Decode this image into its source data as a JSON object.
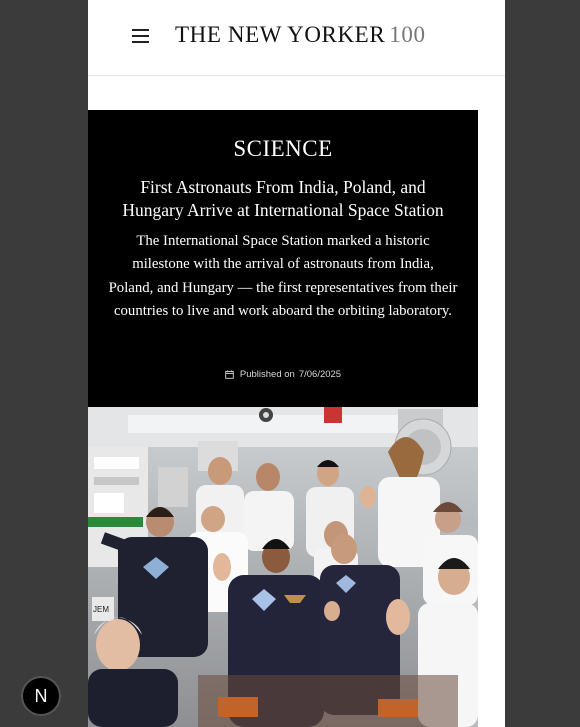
{
  "header": {
    "brand_title": "THE NEW YORKER",
    "brand_number": "100",
    "menu_icon": "hamburger-menu-icon"
  },
  "article": {
    "section": "SCIENCE",
    "headline": "First Astronauts From India, Poland, and Hungary Arrive at International Space Station",
    "dek": "The International Space Station marked a historic milestone with the arrival of astronauts from India, Poland, and Hungary — the first representatives from their countries to live and work aboard the orbiting laboratory.",
    "published_label": "Published on",
    "published_date": "7/06/2025",
    "date_icon": "calendar-icon"
  },
  "photo": {
    "subject": "group-of-astronauts-photo",
    "module_label": "JEM"
  },
  "floating_badge": {
    "label": "N",
    "icon": "n-badge-icon"
  },
  "colors": {
    "backdrop": "#3b3b3b",
    "card_bg": "#000000",
    "brand_number": "#777777"
  }
}
